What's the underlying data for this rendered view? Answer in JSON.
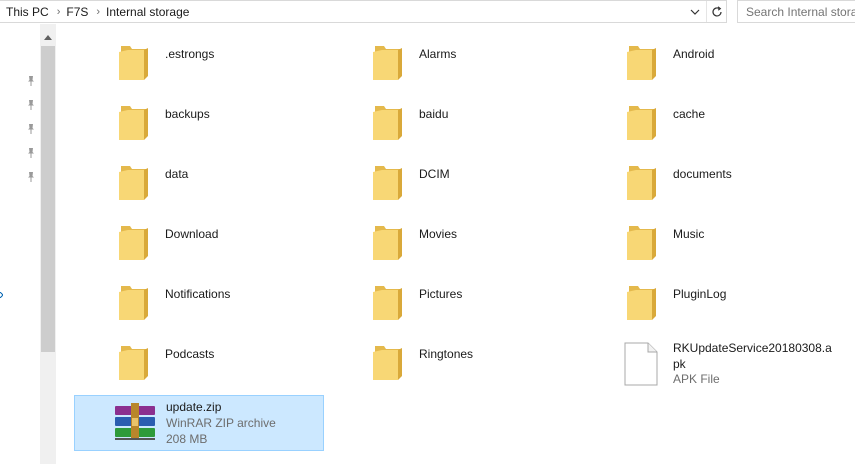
{
  "address": {
    "breadcrumbs": [
      "This PC",
      "F7S",
      "Internal storage"
    ]
  },
  "search": {
    "placeholder": "Search Internal storage"
  },
  "items": [
    {
      "name": ".estrongs",
      "type": "folder"
    },
    {
      "name": "Alarms",
      "type": "folder"
    },
    {
      "name": "Android",
      "type": "folder"
    },
    {
      "name": "backups",
      "type": "folder"
    },
    {
      "name": "baidu",
      "type": "folder"
    },
    {
      "name": "cache",
      "type": "folder"
    },
    {
      "name": "data",
      "type": "folder"
    },
    {
      "name": "DCIM",
      "type": "folder"
    },
    {
      "name": "documents",
      "type": "folder"
    },
    {
      "name": "Download",
      "type": "folder"
    },
    {
      "name": "Movies",
      "type": "folder"
    },
    {
      "name": "Music",
      "type": "folder"
    },
    {
      "name": "Notifications",
      "type": "folder"
    },
    {
      "name": "Pictures",
      "type": "folder"
    },
    {
      "name": "PluginLog",
      "type": "folder"
    },
    {
      "name": "Podcasts",
      "type": "folder"
    },
    {
      "name": "Ringtones",
      "type": "folder"
    },
    {
      "name": "RKUpdateService20180308.apk",
      "type": "file",
      "kind": "APK File"
    }
  ],
  "selected_item": {
    "name": "update.zip",
    "kind": "WinRAR ZIP archive",
    "size": "208 MB"
  },
  "icons": {
    "folder": "folder-icon",
    "apk": "file-icon",
    "zip": "winrar-archive-icon",
    "pin": "pin-icon",
    "dropdown": "chevron-down-icon",
    "refresh": "refresh-icon",
    "scroll_up": "scroll-up-arrow-icon"
  },
  "colors": {
    "folder_front": "#f8d775",
    "folder_back": "#e4b94c",
    "selection_bg": "#cce8ff",
    "selection_border": "#99d1ff",
    "nav_accent": "#0063b1"
  }
}
